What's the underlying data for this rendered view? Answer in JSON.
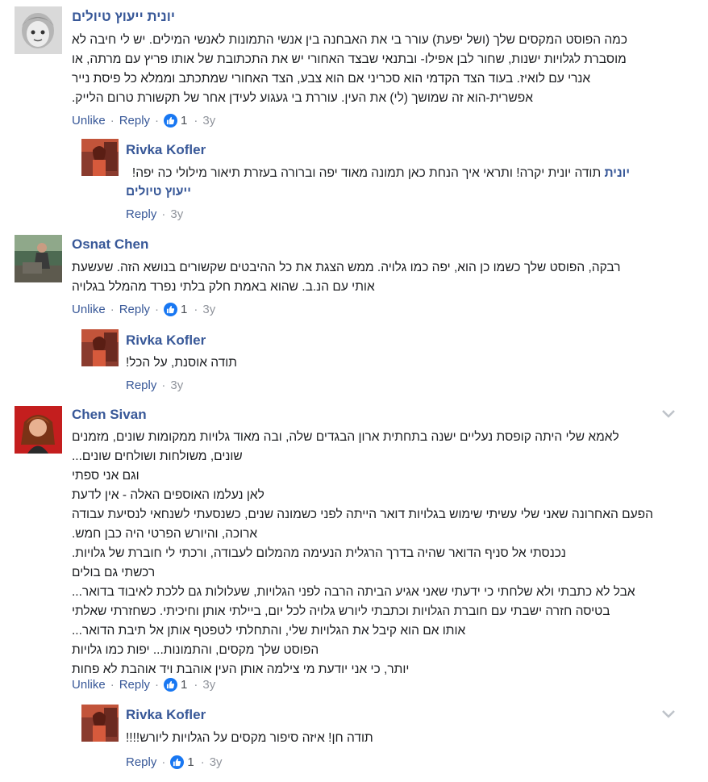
{
  "comments": [
    {
      "author": "יונית ייעוץ טיולים",
      "lines": [
        "כמה הפוסט המקסים שלך (ושל יפעת) עורר בי את האבחנה בין אנשי התמונות לאנשי המילים. יש לי חיבה לא",
        "מוסברת לגלויות ישנות, שחור לבן אפילו- ובתנאי שבצד האחורי יש את התכתובת של אותו פריץ עם מרתה, או",
        "אנרי עם לואיז. בעוד הצד הקדמי הוא סכריני אם הוא צבע, הצד האחורי שמתכתב וממלא כל פיסת נייר",
        "אפשרית-הוא זה שמושך (לי) את העין. עוררת בי געגוע לעידן אחר של תקשורת טרום הלייק."
      ],
      "unlike": "Unlike",
      "reply": "Reply",
      "like_count": "1",
      "time": "3y"
    },
    {
      "author": "Rivka Kofler",
      "lines": [
        "תודה יונית יקרה! ותראי איך הנחת כאן תמונה מאוד יפה וברורה בעזרת תיאור מילולי כה יפה!"
      ],
      "tag_line1": "יונית",
      "tag_line2": "ייעוץ טיולים",
      "reply": "Reply",
      "time": "3y"
    },
    {
      "author": "Osnat Chen",
      "lines": [
        "רבקה, הפוסט שלך כשמו כן הוא, יפה כמו גלויה. ממש הצגת את כל ההיבטים שקשורים בנושא הזה. שעשעת",
        "אותי עם הנ.ב. שהוא באמת חלק בלתי נפרד מהמלל בגלויה"
      ],
      "unlike": "Unlike",
      "reply": "Reply",
      "like_count": "1",
      "time": "3y"
    },
    {
      "author": "Rivka Kofler",
      "lines": [
        "תודה אוסנת, על הכל!"
      ],
      "reply": "Reply",
      "time": "3y"
    },
    {
      "author": "Chen Sivan",
      "lines": [
        "לאמא שלי היתה קופסת נעליים ישנה בתחתית ארון הבגדים שלה, ובה מאוד גלויות ממקומות שונים, מזמנים",
        "שונים, משולחות ושולחים שונים...",
        "וגם אני ספתי",
        "לאן נעלמו האוספים האלה - אין לדעת",
        "הפעם האחרונה שאני שלי עשיתי שימוש בגלויות דואר הייתה לפני כשמונה שנים, כשנסעתי לשנחאי לנסיעת עבודה",
        "ארוכה, והיורש הפרטי היה כבן חמש.",
        "נכנסתי אל סניף הדואר שהיה בדרך הרגלית הנעימה מהמלום לעבודה, ורכתי לי חוברת של גלויות.",
        "רכשתי גם בולים",
        "אבל לא כתבתי ולא שלחתי כי ידעתי שאני אגיע הביתה הרבה לפני הגלויות, שעלולות גם ללכת לאיבוד בדואר...",
        "בטיסה חזרה ישבתי עם חוברת הגלויות וכתבתי ליורש גלויה לכל יום, ביילתי אותן וחיכיתי. כשחזרתי שאלתי",
        "אותו אם הוא קיבל את הגלויות שלי, והתחלתי לטפטף אותן אל תיבת הדואר...",
        "הפוסט שלך מקסים, והתמונות... יפות כמו גלויות",
        "יותר, כי אני יודעת מי צילמה אותן העין אוהבת ויד אוהבת לא פחות"
      ],
      "unlike": "Unlike",
      "reply": "Reply",
      "like_count": "1",
      "time": "3y"
    },
    {
      "author": "Rivka Kofler",
      "lines": [
        "תודה חן! איזה סיפור מקסים על הגלויות ליורש!!!!"
      ],
      "reply": "Reply",
      "like_count": "1",
      "time": "3y"
    }
  ],
  "icons": {
    "like": "like-thumb-icon",
    "menu": "chevron-down-icon"
  },
  "colors": {
    "link": "#385898",
    "like_blue": "#1877f2",
    "meta_gray": "#90949c",
    "text": "#1c1e21"
  }
}
